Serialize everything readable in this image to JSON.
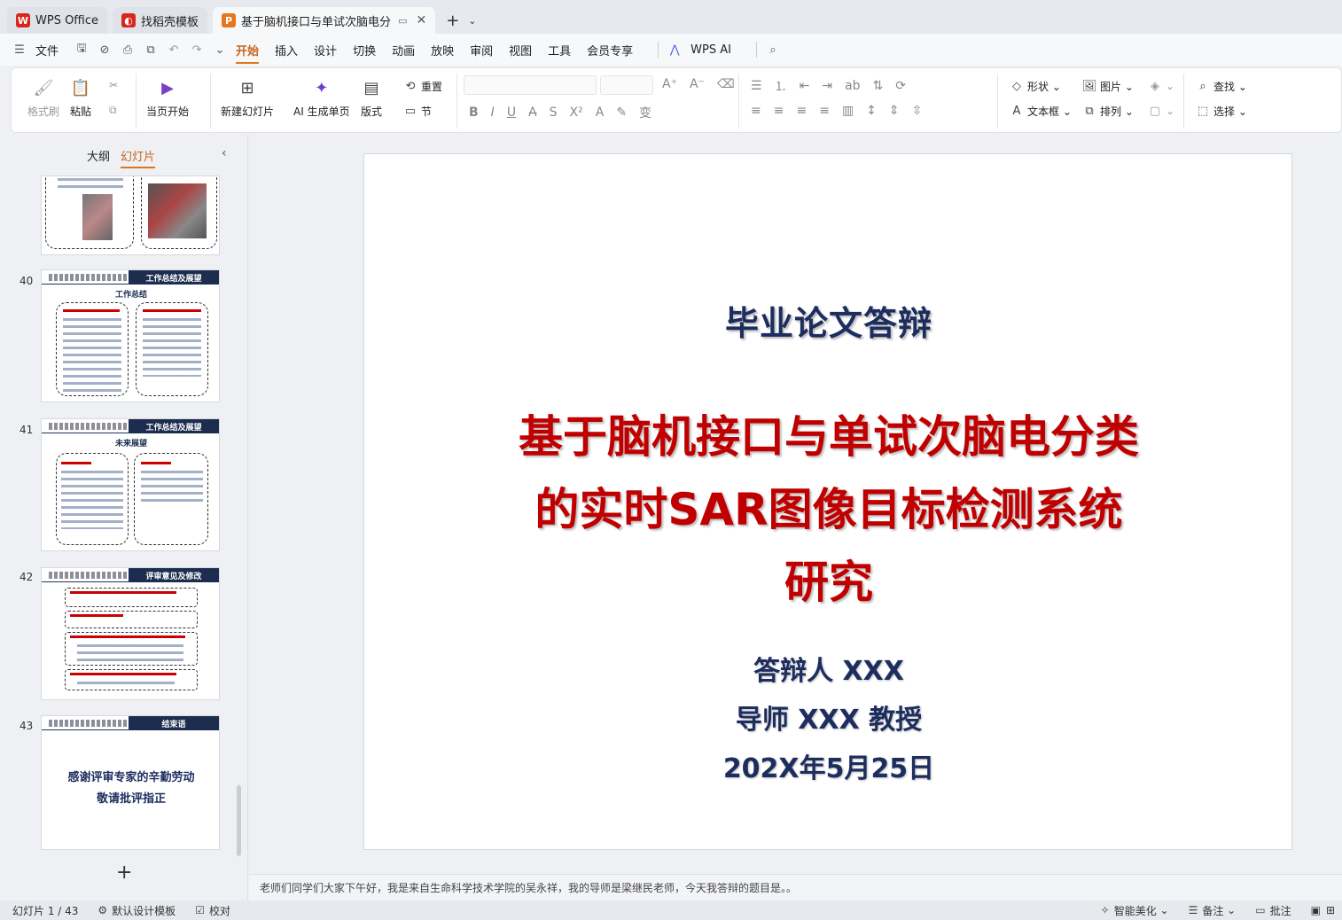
{
  "tabs": [
    {
      "label": "WPS Office",
      "icon": "wps-logo-icon",
      "color": "#d9261c"
    },
    {
      "label": "找稻壳模板",
      "icon": "docer-icon",
      "color": "#d9261c"
    },
    {
      "label": "基于脑机接口与单试次脑电分",
      "icon": "ppt-icon",
      "color": "#e8761c",
      "active": true
    }
  ],
  "menu": {
    "file": "文件",
    "items": [
      "开始",
      "插入",
      "设计",
      "切换",
      "动画",
      "放映",
      "审阅",
      "视图",
      "工具",
      "会员专享"
    ],
    "active": "开始",
    "ai": "WPS AI"
  },
  "ribbon": {
    "format_painter": "格式刷",
    "paste": "粘贴",
    "from_current": "当页开始",
    "new_slide": "新建幻灯片",
    "ai_generate": "AI 生成单页",
    "layout": "版式",
    "reset": "重置",
    "section": "节",
    "shape": "形状",
    "picture": "图片",
    "textbox": "文本框",
    "arrange": "排列",
    "find": "查找",
    "select": "选择"
  },
  "left_panel": {
    "tab_outline": "大纲",
    "tab_slides": "幻灯片",
    "thumbnails": [
      {
        "num": "40",
        "band": "工作总结及展望",
        "subtitle": "工作总结"
      },
      {
        "num": "41",
        "band": "工作总结及展望",
        "subtitle": "未来展望"
      },
      {
        "num": "42",
        "band": "评审意见及修改",
        "subtitle": ""
      },
      {
        "num": "43",
        "band": "结束语",
        "line1": "感谢评审专家的辛勤劳动",
        "line2": "敬请批评指正"
      }
    ]
  },
  "slide": {
    "title": "毕业论文答辩",
    "main_title": "基于脑机接口与单试次脑电分类的实时SAR图像目标检测系统研究",
    "presenter": "答辩人  XXX",
    "advisor": "导师  XXX  教授",
    "date": "202X年5月25日"
  },
  "notes": "老师们同学们大家下午好，我是来自生命科学技术学院的吴永祥，我的导师是梁继民老师，今天我答辩的题目是。。",
  "status": {
    "slide_count": "幻灯片 1 / 43",
    "default_design": "默认设计模板",
    "proofread": "校对",
    "smart_beautify": "智能美化",
    "notes_btn": "备注",
    "comments_btn": "批注"
  },
  "colors": {
    "accent": "#e0761c",
    "slide_title": "#1c2d5e",
    "slide_main": "#c00000",
    "band": "#1c2d4f"
  }
}
